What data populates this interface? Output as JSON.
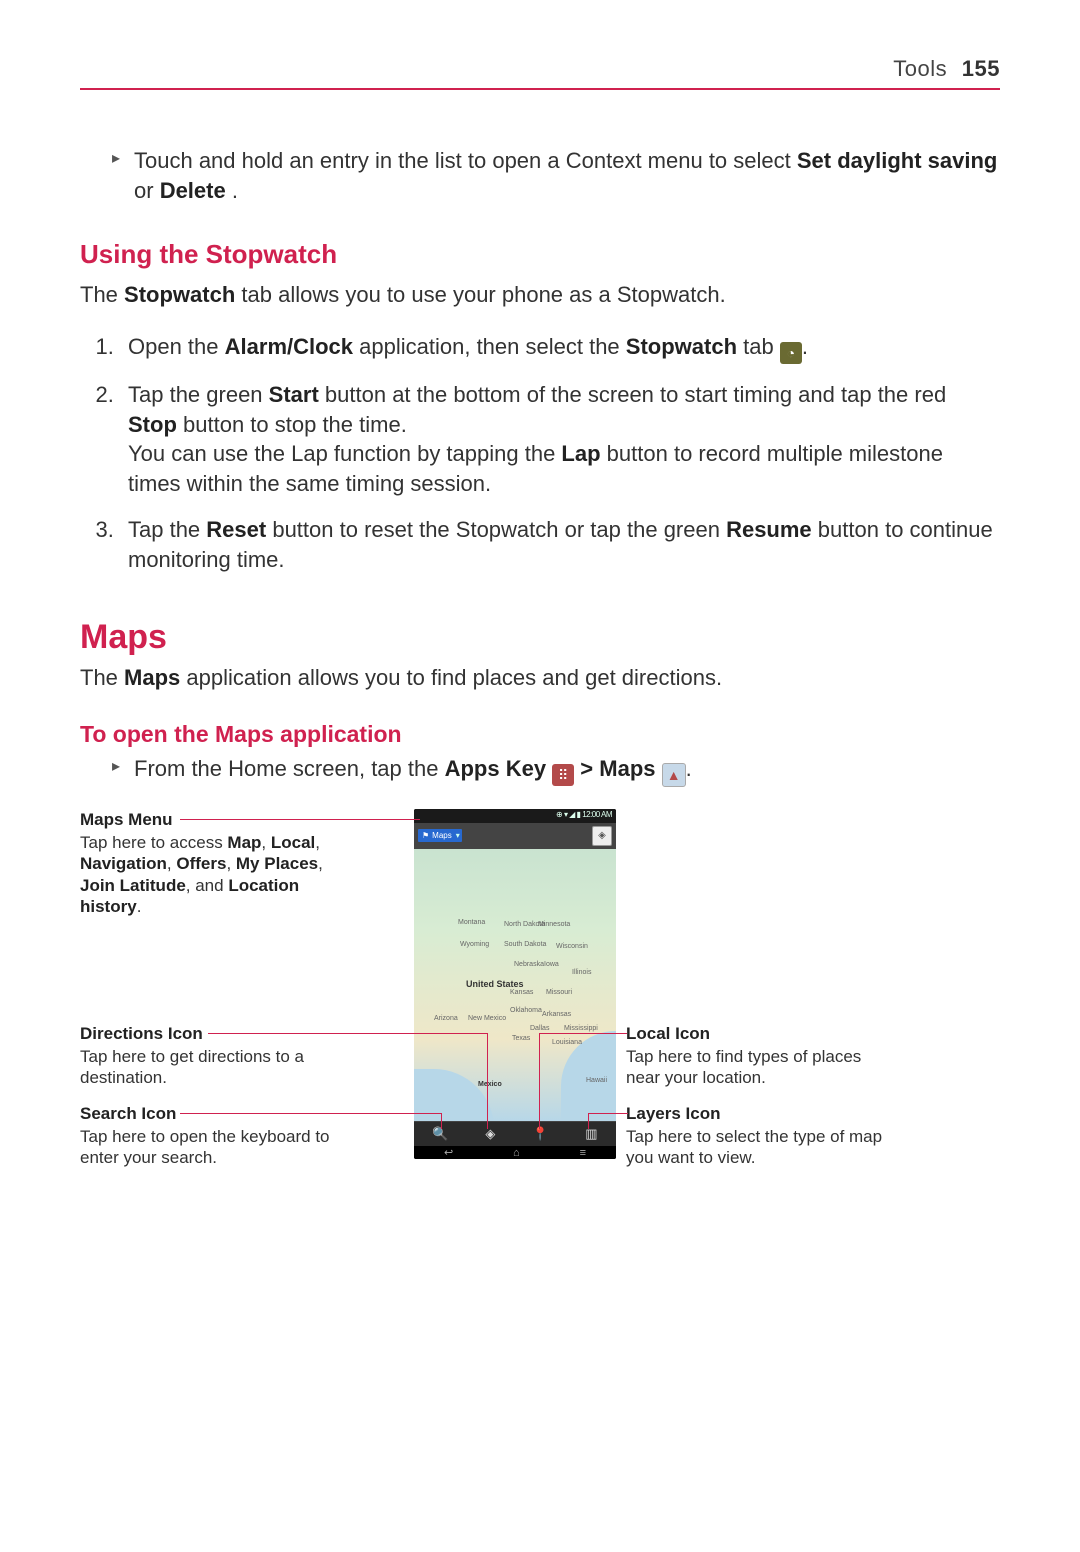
{
  "header": {
    "section": "Tools",
    "page": "155"
  },
  "bullet1": {
    "pre": "Touch and hold an entry in the list to open a Context menu to select ",
    "b1": "Set daylight saving",
    "mid": " or ",
    "b2": "Delete",
    "post": "."
  },
  "stopwatch": {
    "heading": "Using the Stopwatch",
    "intro_pre": "The ",
    "intro_b": "Stopwatch",
    "intro_post": " tab allows you to use your phone as a Stopwatch.",
    "step1_a": "Open the ",
    "step1_b1": "Alarm/Clock",
    "step1_mid": " application, then select the ",
    "step1_b2": "Stopwatch",
    "step1_end": " tab ",
    "step1_tail": ".",
    "step2_a": "Tap the green ",
    "step2_b1": "Start",
    "step2_mid1": " button at the bottom of the screen to start timing and tap the red ",
    "step2_b2": "Stop",
    "step2_mid2": " button to stop the time.",
    "step2_line2a": "You can use the Lap function by tapping the ",
    "step2_b3": "Lap",
    "step2_line2b": " button to record multiple milestone times within the same timing session.",
    "step3_a": "Tap the ",
    "step3_b1": "Reset",
    "step3_mid": " button to reset the Stopwatch or tap the green ",
    "step3_b2": "Resume",
    "step3_end": " button to continue monitoring time."
  },
  "maps": {
    "heading": "Maps",
    "intro_pre": "The ",
    "intro_b": "Maps",
    "intro_post": " application allows you to find places and get directions.",
    "subheading": "To open the Maps application",
    "open_a": "From the Home screen, tap the ",
    "open_b1": "Apps Key ",
    "open_mid": " > ",
    "open_b2": "Maps ",
    "open_end": "."
  },
  "diagram": {
    "status_time": "12:00 AM",
    "menu_label": "Maps",
    "us_label": "United States",
    "map_labels": [
      "Montana",
      "North Dakota",
      "South Dakota",
      "Nebraska",
      "Wyoming",
      "Kansas",
      "Oklahoma",
      "Arkansas",
      "Texas",
      "Mexico",
      "Wisconsin",
      "Missouri",
      "Minnesota",
      "Dallas",
      "Mississippi",
      "Louisiana",
      "Arizona",
      "New Mexico",
      "Hawaii",
      "Illinois",
      "Iowa"
    ],
    "callouts": {
      "maps_menu": {
        "title": "Maps Menu",
        "body_a": "Tap here to access ",
        "b1": "Map",
        "c1": ", ",
        "b2": "Local",
        "c2": ", ",
        "b3": "Navigation",
        "c3": ", ",
        "b4": "Offers",
        "c4": ", ",
        "b5": "My Places",
        "c5": ", ",
        "b6": "Join Latitude",
        "c6": ", and ",
        "b7": "Location history",
        "c7": "."
      },
      "directions": {
        "title": "Directions Icon",
        "body": "Tap here to get directions to a destination."
      },
      "search": {
        "title": "Search Icon",
        "body": "Tap here to open the keyboard to enter your search."
      },
      "local": {
        "title": "Local Icon",
        "body": "Tap here to find types of places near your location."
      },
      "layers": {
        "title": "Layers Icon",
        "body": "Tap here to select the type of map you want to view."
      }
    }
  }
}
